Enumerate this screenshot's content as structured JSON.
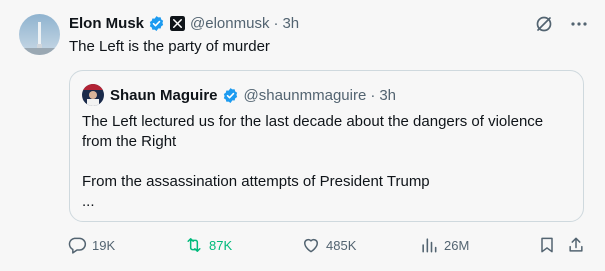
{
  "post": {
    "author_name": "Elon Musk",
    "handle": "@elonmusk",
    "separator": "·",
    "time": "3h",
    "text": "The Left is the party of murder"
  },
  "quoted": {
    "author_name": "Shaun Maguire",
    "handle": "@shaunmmaguire",
    "separator": "·",
    "time": "3h",
    "line1": "The Left lectured us for the last decade about the dangers of violence from the Right",
    "line2": "From the assassination attempts of President Trump",
    "ellipsis": "..."
  },
  "actions": {
    "replies": "19K",
    "reposts": "87K",
    "likes": "485K",
    "views": "26M"
  },
  "colors": {
    "verified": "#1d9bf0",
    "repost_active": "#00ba7c",
    "secondary_text": "#536471"
  },
  "icons": [
    "verified-badge-icon",
    "x-logo-icon",
    "grok-icon",
    "more-icon",
    "reply-icon",
    "repost-icon",
    "like-icon",
    "views-icon",
    "bookmark-icon",
    "share-icon"
  ]
}
